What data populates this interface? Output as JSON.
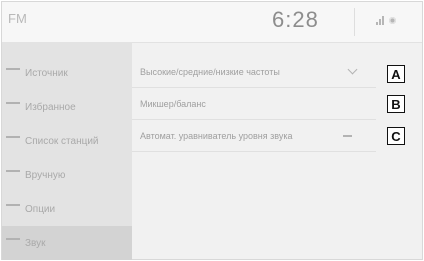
{
  "header": {
    "title": "FM",
    "clock": "6:28"
  },
  "sidebar": {
    "items": [
      {
        "label": "Источник",
        "icon": "source-icon"
      },
      {
        "label": "Избранное",
        "icon": "favorites-icon"
      },
      {
        "label": "Список станций",
        "icon": "station-list-icon"
      },
      {
        "label": "Вручную",
        "icon": "manual-tune-icon"
      },
      {
        "label": "Опции",
        "icon": "options-icon"
      },
      {
        "label": "Звук",
        "icon": "sound-icon",
        "active": true
      }
    ]
  },
  "settings": {
    "rows": [
      {
        "label": "Высокие/средние/низкие частоты",
        "control": "chevron-down-icon",
        "callout": "A"
      },
      {
        "label": "Микшер/баланс",
        "control": "none",
        "callout": "B"
      },
      {
        "label": "Автомат. уравниватель уровня звука",
        "control": "minus-icon",
        "callout": "C"
      }
    ]
  }
}
